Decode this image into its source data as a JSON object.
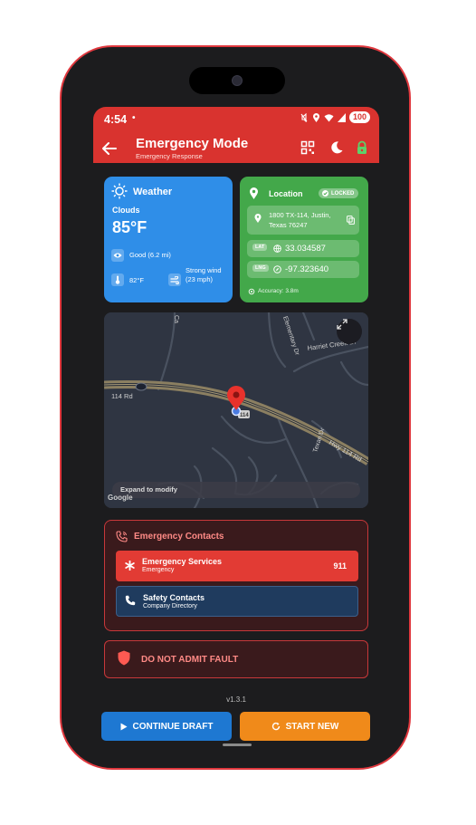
{
  "status": {
    "time": "4:54",
    "dot": "•",
    "battery": "100"
  },
  "appbar": {
    "title": "Emergency Mode",
    "subtitle": "Emergency Response"
  },
  "weather": {
    "title": "Weather",
    "condition": "Clouds",
    "temperature": "85°F",
    "visibility": "Good (6.2 mi)",
    "feels_like": "82°F",
    "wind": "Strong wind (23 mph)"
  },
  "location": {
    "title": "Location",
    "locked_label": "LOCKED",
    "address": "1800 TX-114, Justin, Texas 76247",
    "lat_tag": "LAT",
    "lat": "33.034587",
    "lng_tag": "LNG",
    "lng": "-97.323640",
    "accuracy": "Accuracy: 3.8m"
  },
  "map": {
    "expand_label": "Expand to modify",
    "google": "Google",
    "road_labels": {
      "harriet_creek": "Harriet Creek Dr",
      "elementary": "Elementary Dr",
      "hwy_114": "Hwy 114 Rd",
      "road_114": "114 Rd",
      "texan": "Texan Dr",
      "highway_shield": "114"
    }
  },
  "contacts": {
    "title": "Emergency Contacts",
    "emergency": {
      "name": "Emergency Services",
      "sub": "Emergency",
      "number": "911"
    },
    "safety": {
      "name": "Safety Contacts",
      "sub": "Company Directory"
    }
  },
  "fault_label": "DO NOT ADMIT FAULT",
  "version": "v1.3.1",
  "buttons": {
    "continue": "CONTINUE DRAFT",
    "start": "START NEW"
  },
  "colors": {
    "appbar": "#d9332f",
    "weather_card": "#2f8ee8",
    "location_card": "#43a84a",
    "emergency_row": "#e23b34",
    "safety_row": "#1f3b5e",
    "continue_button": "#1e78d2",
    "start_button": "#f08a1a"
  }
}
